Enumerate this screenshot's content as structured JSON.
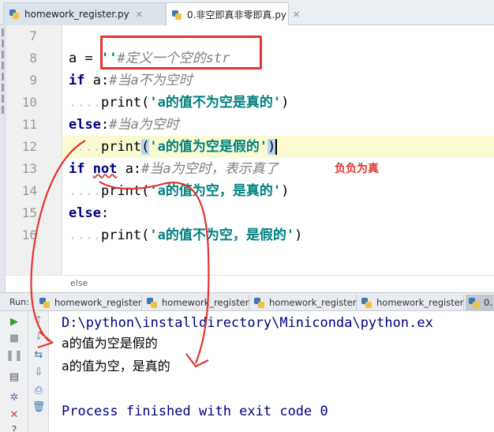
{
  "tabs": [
    {
      "label": "homework_register.py",
      "active": false
    },
    {
      "label": "0.非空即真非零即真.py",
      "active": true
    }
  ],
  "editor": {
    "lines": [
      {
        "num": "7"
      },
      {
        "num": "8",
        "var": "a",
        "op": " = ",
        "str": "''",
        "comment": "#定义一个空的str"
      },
      {
        "num": "9",
        "kw": "if",
        "rest": " a:",
        "comment": "#当a不为空时"
      },
      {
        "num": "10",
        "dots": "....",
        "fn": "print(",
        "str": "'a的值不为空是真的'",
        "close": ")"
      },
      {
        "num": "11",
        "kw": "else",
        "rest": ":",
        "comment": "#当a为空时"
      },
      {
        "num": "12",
        "dots": "....",
        "fn": "print",
        "open": "(",
        "str": "'a的值为空是假的'",
        "close": ")"
      },
      {
        "num": "13",
        "kw": "if",
        "kw2": "not",
        "rest": " a:",
        "comment": "#当a为空时，表示真了"
      },
      {
        "num": "14",
        "dots": "....",
        "fn": "print(",
        "str": "'a的值为空，是真的'",
        "close": ")"
      },
      {
        "num": "15",
        "kw": "else",
        "rest": ":"
      },
      {
        "num": "16",
        "dots": "....",
        "fn": "print(",
        "str": "'a的值不为空，是假的'",
        "close": ")"
      }
    ],
    "annotation": "负负为真",
    "breadcrumb": "else"
  },
  "run": {
    "label": "Run:",
    "tabs": [
      "homework_register",
      "homework_register",
      "homework_register",
      "homework_register",
      "0."
    ],
    "console": {
      "path": "D:\\python\\installdirectory\\Miniconda\\python.ex",
      "output": [
        "a的值为空是假的",
        "a的值为空，是真的"
      ],
      "exit": "Process finished with exit code 0"
    }
  },
  "colors": {
    "annotation_red": "#e3342f",
    "keyword": "#000080",
    "string": "#008080",
    "comment": "#808080"
  }
}
